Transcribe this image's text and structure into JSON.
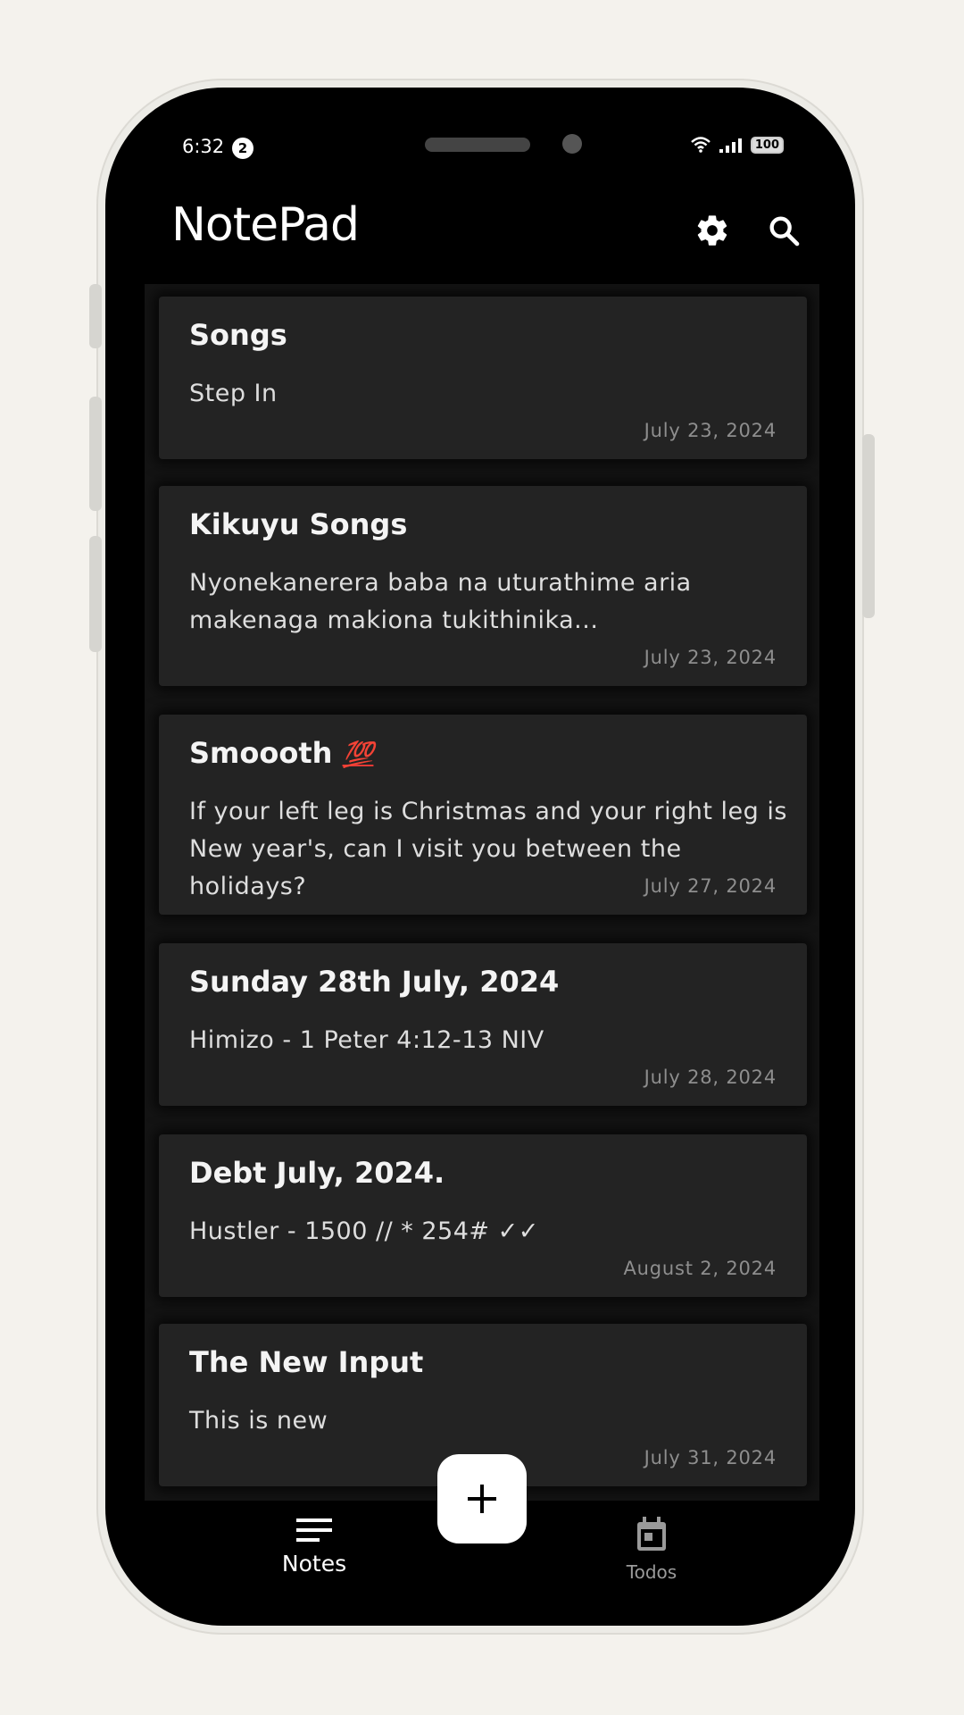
{
  "status_bar": {
    "time": "6:32",
    "notification_count": "2",
    "battery": "100"
  },
  "app_bar": {
    "title": "NotePad",
    "settings_icon": "gear-icon",
    "search_icon": "search-icon"
  },
  "notes": [
    {
      "title": "Songs",
      "body": "Step In",
      "date": "July 23, 2024"
    },
    {
      "title": "Kikuyu Songs",
      "body": "Nyonekanerera baba na uturathime aria makenaga makiona tukithinika...",
      "date": "July 23, 2024"
    },
    {
      "title": "Smoooth",
      "title_emoji": "💯",
      "body": "If your left leg is Christmas and your right leg is New year's, can I visit you between the holidays?",
      "date": "July 27, 2024"
    },
    {
      "title": "Sunday 28th July, 2024",
      "body": "Himizo - 1 Peter 4:12-13 NIV",
      "date": "July 28, 2024"
    },
    {
      "title": "Debt July, 2024.",
      "body": "Hustler - 1500  // * 254# ✓✓",
      "date": "August 2, 2024"
    },
    {
      "title": "The New Input",
      "body": "This is new",
      "date": "July 31, 2024"
    }
  ],
  "fab": {
    "icon": "plus-icon"
  },
  "bottom_nav": {
    "items": [
      {
        "label": "Notes",
        "icon": "notes-icon",
        "active": true
      },
      {
        "label": "Todos",
        "icon": "calendar-icon",
        "active": false
      }
    ]
  }
}
